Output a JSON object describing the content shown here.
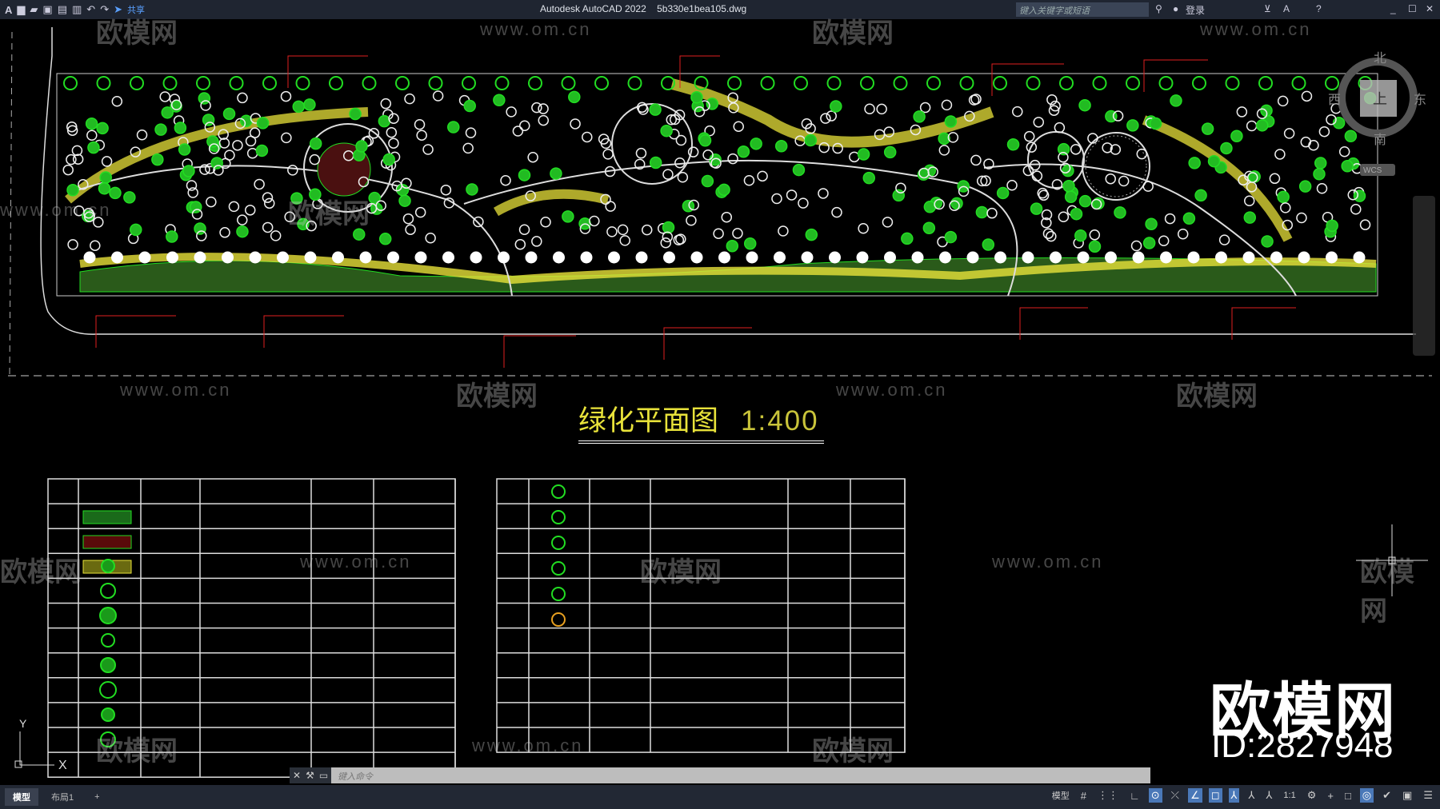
{
  "titlebar": {
    "app_title": "Autodesk AutoCAD 2022",
    "file_name": "5b330e1bea105.dwg",
    "share_label": "共享",
    "search_placeholder": "键入关键字或短语",
    "login_label": "登录"
  },
  "viewcube": {
    "north": "北",
    "south": "南",
    "east": "东",
    "west": "西",
    "top": "上",
    "wcs": "WCS"
  },
  "drawing": {
    "title": "绿化平面图",
    "scale": "1:400"
  },
  "colors": {
    "background": "#000000",
    "green": "#22dd22",
    "yellow": "#e8e23a",
    "red": "#e02020",
    "white": "#ffffff"
  },
  "legend_tables": {
    "left_rows": 12,
    "right_rows": 11
  },
  "axis": {
    "x": "X",
    "y": "Y"
  },
  "command": {
    "placeholder": "键入命令"
  },
  "tabs": [
    {
      "label": "模型"
    },
    {
      "label": "布局1"
    },
    {
      "label": "+"
    }
  ],
  "status": {
    "model": "模型",
    "scale": "1:1"
  },
  "watermark": {
    "brand": "欧模网",
    "url": "www.om.cn",
    "id": "ID:2827948"
  }
}
